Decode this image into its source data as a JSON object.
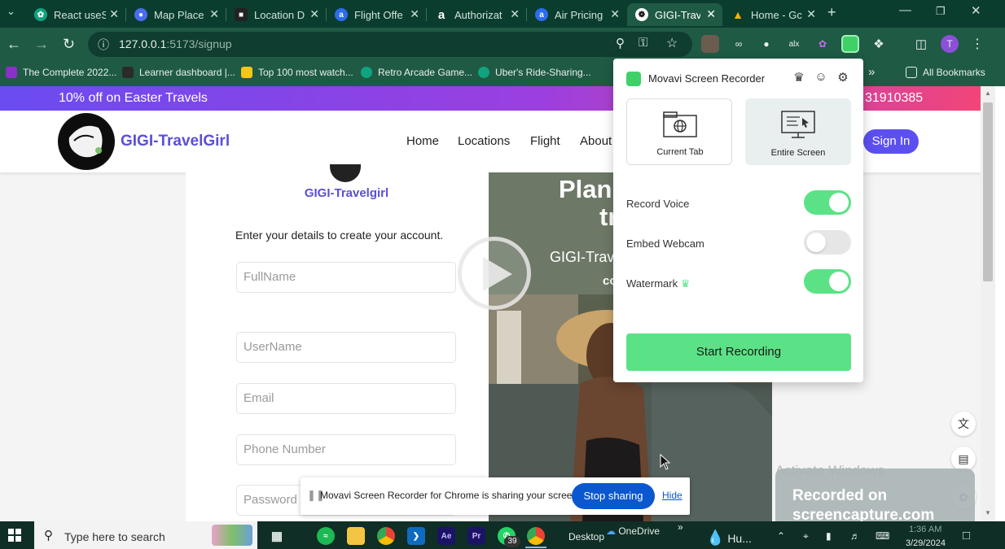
{
  "browser": {
    "tabs": [
      {
        "title": "React useS",
        "icon": "chatgpt-icon",
        "color": "#10a37f"
      },
      {
        "title": "Map Place",
        "icon": "map-pin-icon",
        "color": "#4a6cf0"
      },
      {
        "title": "Location D",
        "icon": "dark-site-icon",
        "color": "#222222"
      },
      {
        "title": "Flight Offe",
        "icon": "amadeus-icon",
        "color": "#2b6cf0"
      },
      {
        "title": "Authorizat",
        "icon": "amazon-a-icon",
        "color": "#0b3d2e"
      },
      {
        "title": "Air Pricing",
        "icon": "amadeus-icon",
        "color": "#2b6cf0"
      },
      {
        "title": "GIGI-Trave",
        "icon": "gigi-logo-icon",
        "color": "#222222"
      },
      {
        "title": "Home - Gc",
        "icon": "google-drive-icon",
        "color": "#f4b400"
      }
    ],
    "active_tab": 6,
    "url_host": "127.0.0.1",
    "url_path": ":5173/signup",
    "bookmarks": [
      {
        "label": "The Complete 2022...",
        "color": "#8b2fc9"
      },
      {
        "label": "Learner dashboard |...",
        "color": "#2b2b2b"
      },
      {
        "label": "Top 100 most watch...",
        "color": "#f5c518"
      },
      {
        "label": "Retro Arcade Game...",
        "color": "#10a37f"
      },
      {
        "label": "Uber's Ride-Sharing...",
        "color": "#10a37f"
      }
    ],
    "all_bookmarks": "All Bookmarks"
  },
  "site": {
    "promo": "10% off on Easter Travels",
    "promo_phone": "31910385",
    "brand": "GIGI-TravelGirl",
    "nav": [
      "Home",
      "Locations",
      "Flight",
      "About"
    ],
    "sign_in": "Sign In",
    "form_brand": "GIGI-Travelgirl",
    "form_subtitle": "Enter your details to create your account.",
    "fields": [
      "FullName",
      "UserName",
      "Email",
      "Phone Number",
      "Password"
    ],
    "hero_title_1": "Plan",
    "hero_title_2": "tr",
    "hero_brand": "GIGI-Trav",
    "hero_small": "co"
  },
  "recorder": {
    "title": "Movavi Screen Recorder",
    "modes": [
      {
        "label": "Current Tab",
        "selected": false
      },
      {
        "label": "Entire Screen",
        "selected": true
      }
    ],
    "options": [
      {
        "label": "Record Voice",
        "on": true
      },
      {
        "label": "Embed Webcam",
        "on": false
      },
      {
        "label": "Watermark",
        "on": true
      }
    ],
    "start": "Start Recording",
    "accent": "#5ce286"
  },
  "sharebar": {
    "text": "Movavi Screen Recorder for Chrome is sharing your screen.",
    "stop": "Stop sharing",
    "hide": "Hide"
  },
  "watermark": {
    "activate": "Activate Windows",
    "line1": "Recorded on",
    "line2": "screencapture.com"
  },
  "taskbar": {
    "search_placeholder": "Type here to search",
    "desktop": "Desktop",
    "onedrive": "OneDrive",
    "weather": "Hu...",
    "whatsapp_badge": "39",
    "time": "1:36 AM",
    "date": "3/29/2024"
  }
}
